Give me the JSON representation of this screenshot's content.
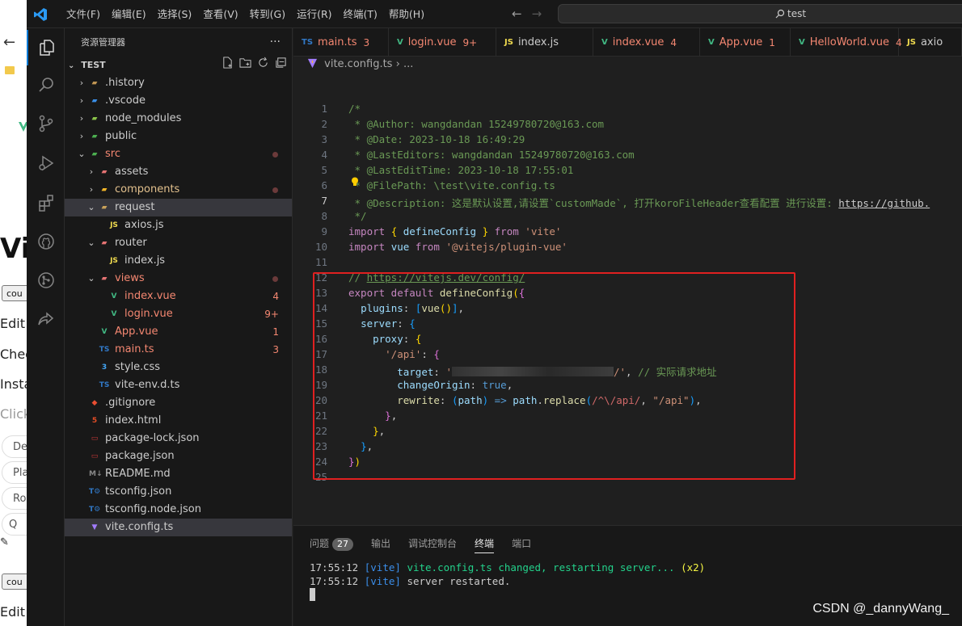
{
  "browser": {
    "back": "←",
    "heading": "Vi",
    "btn1": "cou",
    "btn2": "cou",
    "t1": "Edit",
    "t2": "Chec",
    "t3": "Insta",
    "t4": "Click",
    "p1": "De",
    "p2": "Pla",
    "p3": "Ro",
    "p4": "Q",
    "t5": "Edit"
  },
  "titlebar": {
    "menu": [
      "文件(F)",
      "编辑(E)",
      "选择(S)",
      "查看(V)",
      "转到(G)",
      "运行(R)",
      "终端(T)",
      "帮助(H)"
    ],
    "search": "test"
  },
  "sidebar": {
    "title": "资源管理器",
    "root": "TEST",
    "tree": [
      {
        "label": "history",
        "prefix": ".",
        "badge": "",
        "color": "#cccccc"
      },
      {
        "label": ".vscode",
        "badge": "",
        "color": "#cccccc"
      },
      {
        "label": "node_modules",
        "badge": "",
        "color": "#cccccc"
      },
      {
        "label": "public",
        "badge": "",
        "color": "#cccccc"
      },
      {
        "label": "src",
        "badge": "",
        "color": "#f48771"
      },
      {
        "label": "assets",
        "badge": "",
        "color": "#cccccc"
      },
      {
        "label": "components",
        "badge": "",
        "color": "#e2c08d"
      },
      {
        "label": "request",
        "badge": "",
        "color": "#cccccc"
      },
      {
        "label": "axios.js",
        "badge": "",
        "color": "#cccccc"
      },
      {
        "label": "router",
        "badge": "",
        "color": "#cccccc"
      },
      {
        "label": "index.js",
        "badge": "",
        "color": "#cccccc"
      },
      {
        "label": "views",
        "badge": "",
        "color": "#f48771"
      },
      {
        "label": "index.vue",
        "badge": "4",
        "color": "#f48771"
      },
      {
        "label": "login.vue",
        "badge": "9+",
        "color": "#f48771"
      },
      {
        "label": "App.vue",
        "badge": "1",
        "color": "#f48771"
      },
      {
        "label": "main.ts",
        "badge": "3",
        "color": "#f48771"
      },
      {
        "label": "style.css",
        "badge": "",
        "color": "#cccccc"
      },
      {
        "label": "vite-env.d.ts",
        "badge": "",
        "color": "#cccccc"
      },
      {
        "label": ".gitignore",
        "badge": "",
        "color": "#cccccc"
      },
      {
        "label": "index.html",
        "badge": "",
        "color": "#cccccc"
      },
      {
        "label": "package-lock.json",
        "badge": "",
        "color": "#cccccc"
      },
      {
        "label": "package.json",
        "badge": "",
        "color": "#cccccc"
      },
      {
        "label": "README.md",
        "badge": "",
        "color": "#cccccc"
      },
      {
        "label": "tsconfig.json",
        "badge": "",
        "color": "#cccccc"
      },
      {
        "label": "tsconfig.node.json",
        "badge": "",
        "color": "#cccccc"
      },
      {
        "label": "vite.config.ts",
        "badge": "",
        "color": "#cccccc"
      }
    ]
  },
  "tabs": [
    {
      "icon": "TS",
      "label": "main.ts",
      "badge": "3"
    },
    {
      "icon": "V",
      "label": "login.vue",
      "badge": "9+"
    },
    {
      "icon": "JS",
      "label": "index.js",
      "badge": ""
    },
    {
      "icon": "V",
      "label": "index.vue",
      "badge": "4"
    },
    {
      "icon": "V",
      "label": "App.vue",
      "badge": "1"
    },
    {
      "icon": "V",
      "label": "HelloWorld.vue",
      "badge": "4"
    },
    {
      "icon": "JS",
      "label": "axio",
      "badge": ""
    }
  ],
  "breadcrumb": {
    "file": "vite.config.ts",
    "sep": "›",
    "tail": "..."
  },
  "code": {
    "l1": "/*",
    "l2": " * @Author: wangdandan 15249780720@163.com",
    "l3": " * @Date: 2023-10-18 16:49:29",
    "l4": " * @LastEditors: wangdandan 15249780720@163.com",
    "l5": " * @LastEditTime: 2023-10-18 17:55:01",
    "l6": " * @FilePath: \\test\\vite.config.ts",
    "l7": " * @Description: 这是默认设置,请设置`customMade`, 打开koroFileHeader查看配置 进行设置: ",
    "l7link": "https://github.",
    "l8": " */",
    "l12com": "// ",
    "l12link": "https://vitejs.dev/config/",
    "l18comment": "// 实际请求地址",
    "l18tail": "/"
  },
  "panel": {
    "tabs": [
      "问题",
      "输出",
      "调试控制台",
      "终端",
      "端口"
    ],
    "problems_count": "27",
    "line1_time": "17:55:12",
    "line1_tag": "[vite]",
    "line1_msg": "vite.config.ts changed, restarting server...",
    "line1_count": "(x2)",
    "line2_time": "17:55:12",
    "line2_tag": "[vite]",
    "line2_msg": "server restarted."
  },
  "watermark": "CSDN @_dannyWang_"
}
